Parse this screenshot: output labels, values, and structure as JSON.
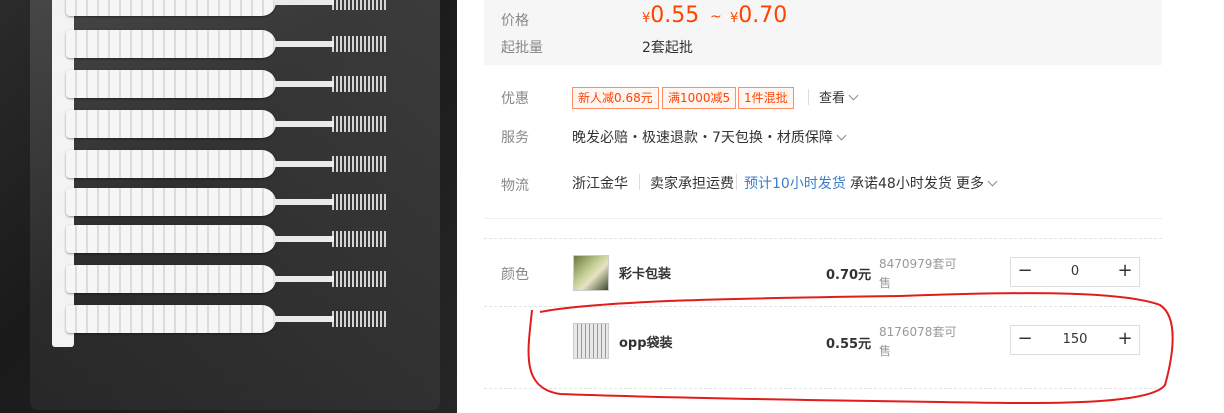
{
  "pricing": {
    "label": "价格",
    "currency": "¥",
    "min": "0.55",
    "separator": "~",
    "max": "0.70",
    "moq_label": "起批量",
    "moq_value": "2套起批"
  },
  "promo": {
    "label": "优惠",
    "tags": [
      "新人减0.68元",
      "满1000减5",
      "1件混批"
    ],
    "view_label": "查看"
  },
  "service": {
    "label": "服务",
    "text": "晚发必赔・极速退款・7天包换・材质保障"
  },
  "logistics": {
    "label": "物流",
    "origin": "浙江金华",
    "shipping_fee": "卖家承担运费",
    "eta": "预计10小时发货",
    "promise": "承诺48小时发货",
    "more_label": "更多"
  },
  "color": {
    "label": "颜色",
    "skus": [
      {
        "name": "彩卡包装",
        "price": "0.70元",
        "stock": "8470979套可售",
        "qty": "0"
      },
      {
        "name": "opp袋装",
        "price": "0.55元",
        "stock": "8176078套可售",
        "qty": "150"
      }
    ],
    "minus_symbol": "−",
    "plus_symbol": "+"
  },
  "colors": {
    "price_red": "#ff4400",
    "link_blue": "#3b7ec9",
    "annotation_red": "#e31b1b"
  }
}
